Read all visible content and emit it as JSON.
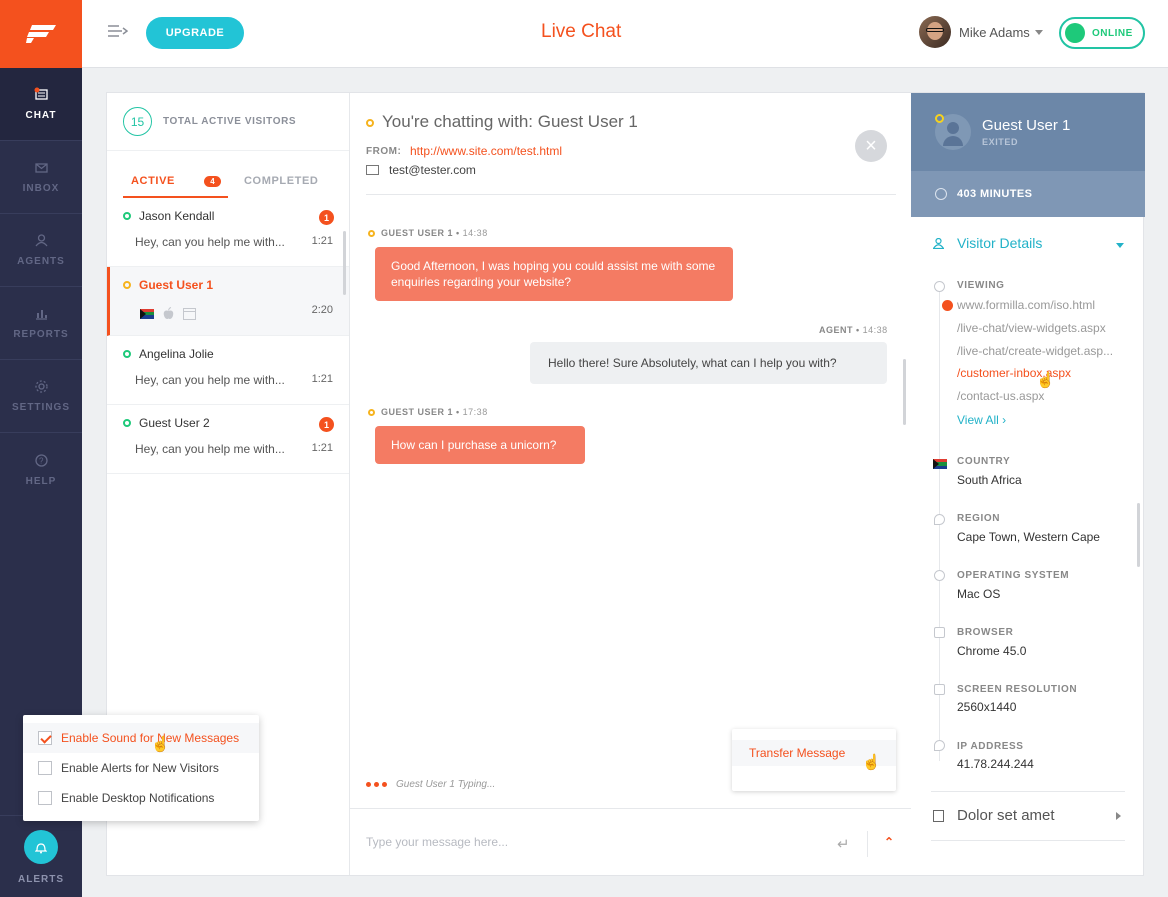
{
  "app": {
    "title": "Live Chat",
    "upgrade_label": "UPGRADE"
  },
  "colors": {
    "brand": "#f4511e",
    "accent": "#22c4d6",
    "online": "#1ec97a",
    "sidebar": "#2b2f4b",
    "details_header": "#6c87a8"
  },
  "sidebar": {
    "items": [
      {
        "label": "CHAT",
        "icon": "chat-icon"
      },
      {
        "label": "INBOX",
        "icon": "inbox-icon"
      },
      {
        "label": "AGENTS",
        "icon": "agents-icon"
      },
      {
        "label": "REPORTS",
        "icon": "reports-icon"
      },
      {
        "label": "SETTINGS",
        "icon": "settings-icon"
      },
      {
        "label": "HELP",
        "icon": "help-icon"
      }
    ],
    "alerts_label": "ALERTS"
  },
  "user": {
    "name": "Mike Adams",
    "status": "ONLINE"
  },
  "visitors": {
    "total": "15",
    "total_label": "TOTAL ACTIVE VISITORS",
    "tab_active": "ACTIVE",
    "tab_active_count": "4",
    "tab_completed": "COMPLETED",
    "list": [
      {
        "name": "Jason Kendall",
        "message": "Hey, can you help me with...",
        "time": "1:21",
        "unread": "1"
      },
      {
        "name": "Guest User 1",
        "time": "2:20"
      },
      {
        "name": "Angelina Jolie",
        "message": "Hey, can you help me with...",
        "time": "1:21"
      },
      {
        "name": "Guest User 2",
        "message": "Hey, can you help me with...",
        "time": "1:21",
        "unread": "1"
      }
    ]
  },
  "chat": {
    "heading": "You're chatting with: Guest User 1",
    "from_label": "FROM:",
    "from_url": "http://www.site.com/test.html",
    "email": "test@tester.com",
    "messages": [
      {
        "author": "GUEST USER 1",
        "time": "14:38",
        "text": "Good Afternoon, I was hoping you could assist me with some enquiries regarding your website?"
      },
      {
        "author": "AGENT",
        "time": "14:38",
        "text": "Hello there! Sure Absolutely, what can I help you with?"
      },
      {
        "author": "GUEST USER 1",
        "time": "17:38",
        "text": "How can I purchase a unicorn?"
      }
    ],
    "typing": "Guest User 1 Typing...",
    "transfer": "Transfer Message",
    "composer_placeholder": "Type your message here..."
  },
  "details": {
    "name": "Guest User 1",
    "status": "EXITED",
    "duration": "403 MINUTES",
    "section_title": "Visitor Details",
    "viewing_label": "VIEWING",
    "viewing": [
      "www.formilla.com/iso.html",
      "/live-chat/view-widgets.aspx",
      "/live-chat/create-widget.asp...",
      "/customer-inbox.aspx",
      "/contact-us.aspx"
    ],
    "view_all": "View All ›",
    "country_label": "COUNTRY",
    "country": "South Africa",
    "region_label": "REGION",
    "region": "Cape Town, Western Cape",
    "os_label": "OPERATING SYSTEM",
    "os": "Mac OS",
    "browser_label": "BROWSER",
    "browser": "Chrome 45.0",
    "resolution_label": "SCREEN RESOLUTION",
    "resolution": "2560x1440",
    "ip_label": "IP ADDRESS",
    "ip": "41.78.244.244",
    "extra": "Dolor set amet"
  },
  "notifications": [
    {
      "label": "Enable Sound for New Messages",
      "checked": true
    },
    {
      "label": "Enable Alerts for New Visitors",
      "checked": false
    },
    {
      "label": "Enable Desktop Notifications",
      "checked": false
    }
  ]
}
